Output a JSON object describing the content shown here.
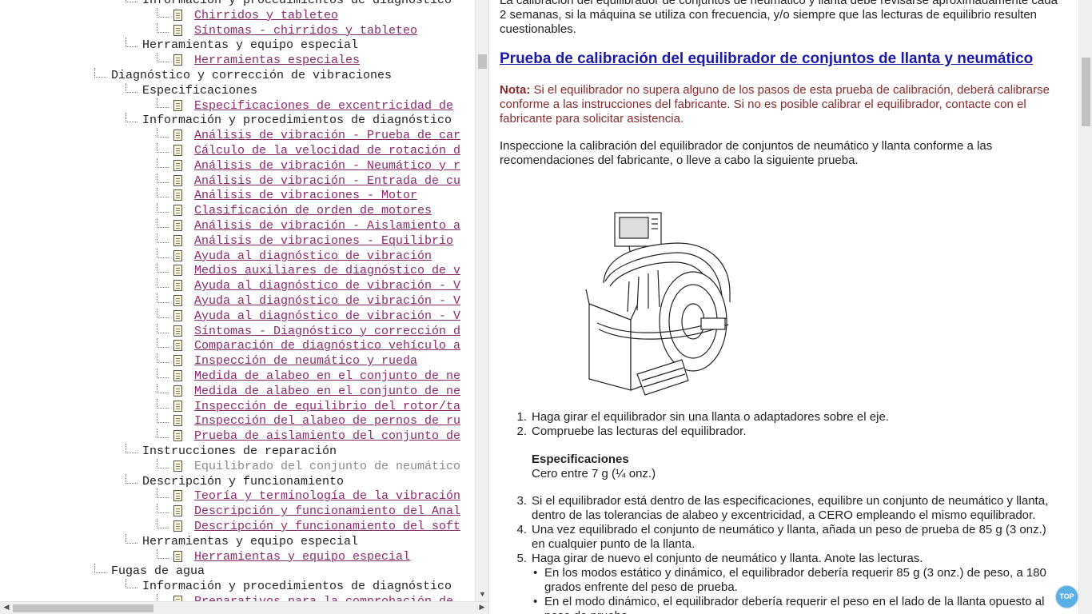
{
  "tree": {
    "items": [
      {
        "label": "Información y procedimientos de diagnóstico",
        "level": 1,
        "kind": "folder"
      },
      {
        "label": "Chirridos y tableteo",
        "level": 2,
        "kind": "link"
      },
      {
        "label": "Síntomas - chirridos y tableteo",
        "level": 2,
        "kind": "link"
      },
      {
        "label": "Herramientas y equipo especial",
        "level": 1,
        "kind": "folder"
      },
      {
        "label": "Herramientas especiales",
        "level": 2,
        "kind": "link"
      },
      {
        "label": "Diagnóstico y corrección de vibraciones",
        "level": 0,
        "kind": "folder"
      },
      {
        "label": "Especificaciones",
        "level": 1,
        "kind": "folder"
      },
      {
        "label": "Especificaciones de excentricidad de",
        "level": 2,
        "kind": "link"
      },
      {
        "label": "Información y procedimientos de diagnóstico",
        "level": 1,
        "kind": "folder"
      },
      {
        "label": "Análisis de vibración - Prueba de car",
        "level": 2,
        "kind": "link"
      },
      {
        "label": "Cálculo de la velocidad de rotación d",
        "level": 2,
        "kind": "link"
      },
      {
        "label": "Análisis de vibración - Neumático y r",
        "level": 2,
        "kind": "link"
      },
      {
        "label": "Análisis de vibración - Entrada de cu",
        "level": 2,
        "kind": "link"
      },
      {
        "label": "Análisis de vibraciones - Motor",
        "level": 2,
        "kind": "link"
      },
      {
        "label": "Clasificación de orden de motores",
        "level": 2,
        "kind": "link"
      },
      {
        "label": "Análisis de vibración - Aislamiento a",
        "level": 2,
        "kind": "link"
      },
      {
        "label": "Análisis de vibraciones - Equilibrio",
        "level": 2,
        "kind": "link"
      },
      {
        "label": "Ayuda al diagnóstico de vibración",
        "level": 2,
        "kind": "link"
      },
      {
        "label": "Medios auxiliares de diagnóstico de v",
        "level": 2,
        "kind": "link"
      },
      {
        "label": "Ayuda al diagnóstico de vibración - V",
        "level": 2,
        "kind": "link"
      },
      {
        "label": "Ayuda al diagnóstico de vibración - V",
        "level": 2,
        "kind": "link"
      },
      {
        "label": "Ayuda al diagnóstico de vibración - V",
        "level": 2,
        "kind": "link"
      },
      {
        "label": "Síntomas - Diagnóstico y corrección d",
        "level": 2,
        "kind": "link"
      },
      {
        "label": "Comparación de diagnóstico vehículo a",
        "level": 2,
        "kind": "link"
      },
      {
        "label": "Inspección de neumático y rueda",
        "level": 2,
        "kind": "link"
      },
      {
        "label": "Medida de alabeo en el conjunto de ne",
        "level": 2,
        "kind": "link"
      },
      {
        "label": "Medida de alabeo en el conjunto de ne",
        "level": 2,
        "kind": "link"
      },
      {
        "label": "Inspección de equilibrio del rotor/ta",
        "level": 2,
        "kind": "link"
      },
      {
        "label": "Inspección del alabeo de pernos de ru",
        "level": 2,
        "kind": "link"
      },
      {
        "label": "Prueba de aislamiento del conjunto de",
        "level": 2,
        "kind": "link"
      },
      {
        "label": "Instrucciones de reparación",
        "level": 1,
        "kind": "folder"
      },
      {
        "label": "Equilibrado del conjunto de neumático",
        "level": 2,
        "kind": "visited"
      },
      {
        "label": "Descripción y funcionamiento",
        "level": 1,
        "kind": "folder"
      },
      {
        "label": "Teoría y terminología de la vibración",
        "level": 2,
        "kind": "link"
      },
      {
        "label": "Descripción y funcionamiento del Anal",
        "level": 2,
        "kind": "link"
      },
      {
        "label": "Descripción y funcionamiento del soft",
        "level": 2,
        "kind": "link"
      },
      {
        "label": "Herramientas y equipo especial",
        "level": 1,
        "kind": "folder"
      },
      {
        "label": "Herramientas y equipo especial",
        "level": 2,
        "kind": "link"
      },
      {
        "label": "Fugas de agua",
        "level": 0,
        "kind": "folder"
      },
      {
        "label": "Información y procedimientos de diagnóstico",
        "level": 1,
        "kind": "folder"
      },
      {
        "label": "Preparativos para la comprobación de",
        "level": 2,
        "kind": "link"
      }
    ]
  },
  "content": {
    "intro": "La calibración del equilibrador de conjuntos de neumático y llanta debe revisarse aproximadamente cada 2 semanas, si la máquina se utiliza con frecuencia, y/o siempre que las lecturas de equilibrio resulten cuestionables.",
    "heading": "Prueba de calibración del equilibrador de conjuntos de llanta y neumático",
    "note_label": "Nota:",
    "note_text": " Si el equilibrador no supera alguno de los pasos de esta prueba de calibración, deberá calibrarse conforme a las instrucciones del fabricante. Si no es posible calibrar el equilibrador, contacte con el fabricante para solicitar asistencia.",
    "inspect": "Inspeccione la calibración del equilibrador de conjuntos de neumático y llanta conforme a las recomendaciones del fabricante, o lleve a cabo la siguiente prueba.",
    "steps_a": [
      {
        "num": "1.",
        "text": "Haga girar el equilibrador sin una llanta o adaptadores sobre el eje."
      },
      {
        "num": "2.",
        "text": "Compruebe las lecturas del equilibrador."
      }
    ],
    "spec_title": "Especificaciones",
    "spec_value": "Cero entre 7 g (¼ onz.)",
    "steps_b": [
      {
        "num": "3.",
        "text": "Si el equilibrador está dentro de las especificaciones, equilibre un conjunto de neumático y llanta, dentro de las tolerancias de alabeo y excentricidad, a CERO empleando el mismo equilibrador."
      },
      {
        "num": "4.",
        "text": "Una vez equilibrado el conjunto de neumático y llanta, añada un peso de prueba de 85 g (3 onz.) en cualquier punto de la llanta."
      },
      {
        "num": "5.",
        "text": "Haga girar de nuevo el conjunto de neumático y llanta. Anote las lecturas."
      }
    ],
    "bullets": [
      {
        "dot": "•",
        "text": "En los modos estático y dinámico, el equilibrador debería requerir 85 g (3 onz.) de peso, a 180 grados enfrente del peso de prueba."
      },
      {
        "dot": "•",
        "text": "En el modo dinámico, el equilibrador debería requerir el peso en el lado de la llanta opuesto al peso de prueba."
      }
    ],
    "top_button": "TOP"
  }
}
